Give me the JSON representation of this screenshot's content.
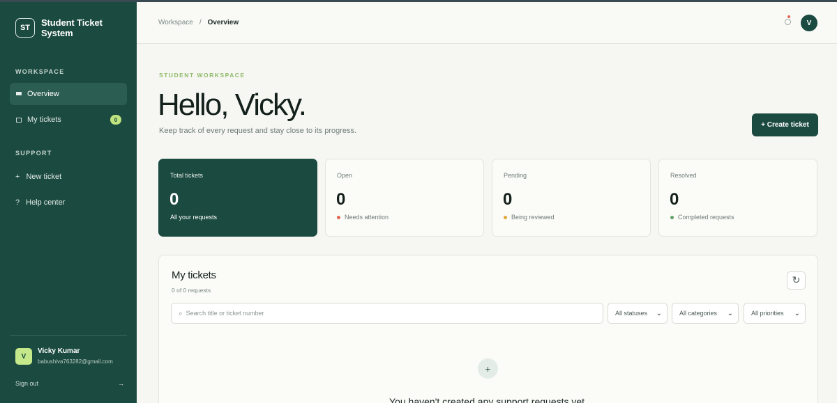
{
  "sidebar": {
    "brand_logo": "ST",
    "brand_name": "Student Ticket System",
    "workspace_label": "WORKSPACE",
    "items": [
      {
        "label": "Overview",
        "icon": "grid-icon",
        "active": true
      },
      {
        "label": "My tickets",
        "icon": "list-icon",
        "badge": "0"
      }
    ],
    "support_label": "SUPPORT",
    "support_items": [
      {
        "glyph": "+",
        "label": "New ticket"
      },
      {
        "glyph": "?",
        "label": "Help center"
      }
    ],
    "user": {
      "initial": "V",
      "name": "Vicky Kumar",
      "email": "babushiva763282@gmail.com"
    },
    "signout": {
      "label": "Sign out",
      "arrow": "→"
    }
  },
  "topbar": {
    "crumb_root": "Workspace",
    "crumb_sep": "/",
    "crumb_current": "Overview",
    "avatar_initial": "V"
  },
  "hero": {
    "eyebrow": "STUDENT WORKSPACE",
    "greeting": "Hello, Vicky.",
    "subtitle": "Keep track of every request and stay close to its progress.",
    "create_button": "+  Create ticket"
  },
  "stats": [
    {
      "label": "Total tickets",
      "value": "0",
      "note": "All your requests"
    },
    {
      "label": "Open",
      "value": "0",
      "note": "Needs attention",
      "dot_color": "#e2674e"
    },
    {
      "label": "Pending",
      "value": "0",
      "note": "Being reviewed",
      "dot_color": "#e0a83c"
    },
    {
      "label": "Resolved",
      "value": "0",
      "note": "Completed requests",
      "dot_color": "#5ea265"
    }
  ],
  "tickets_panel": {
    "title": "My tickets",
    "count": "0 of 0 requests",
    "search_placeholder": "Search title or ticket number",
    "filters": {
      "status": "All statuses",
      "category": "All categories",
      "priority": "All priorities"
    },
    "empty_text": "You haven't created any support requests yet."
  },
  "colors": {
    "brand": "#1b4a40",
    "accent": "#bfe37f",
    "background": "#f6f6f2"
  }
}
